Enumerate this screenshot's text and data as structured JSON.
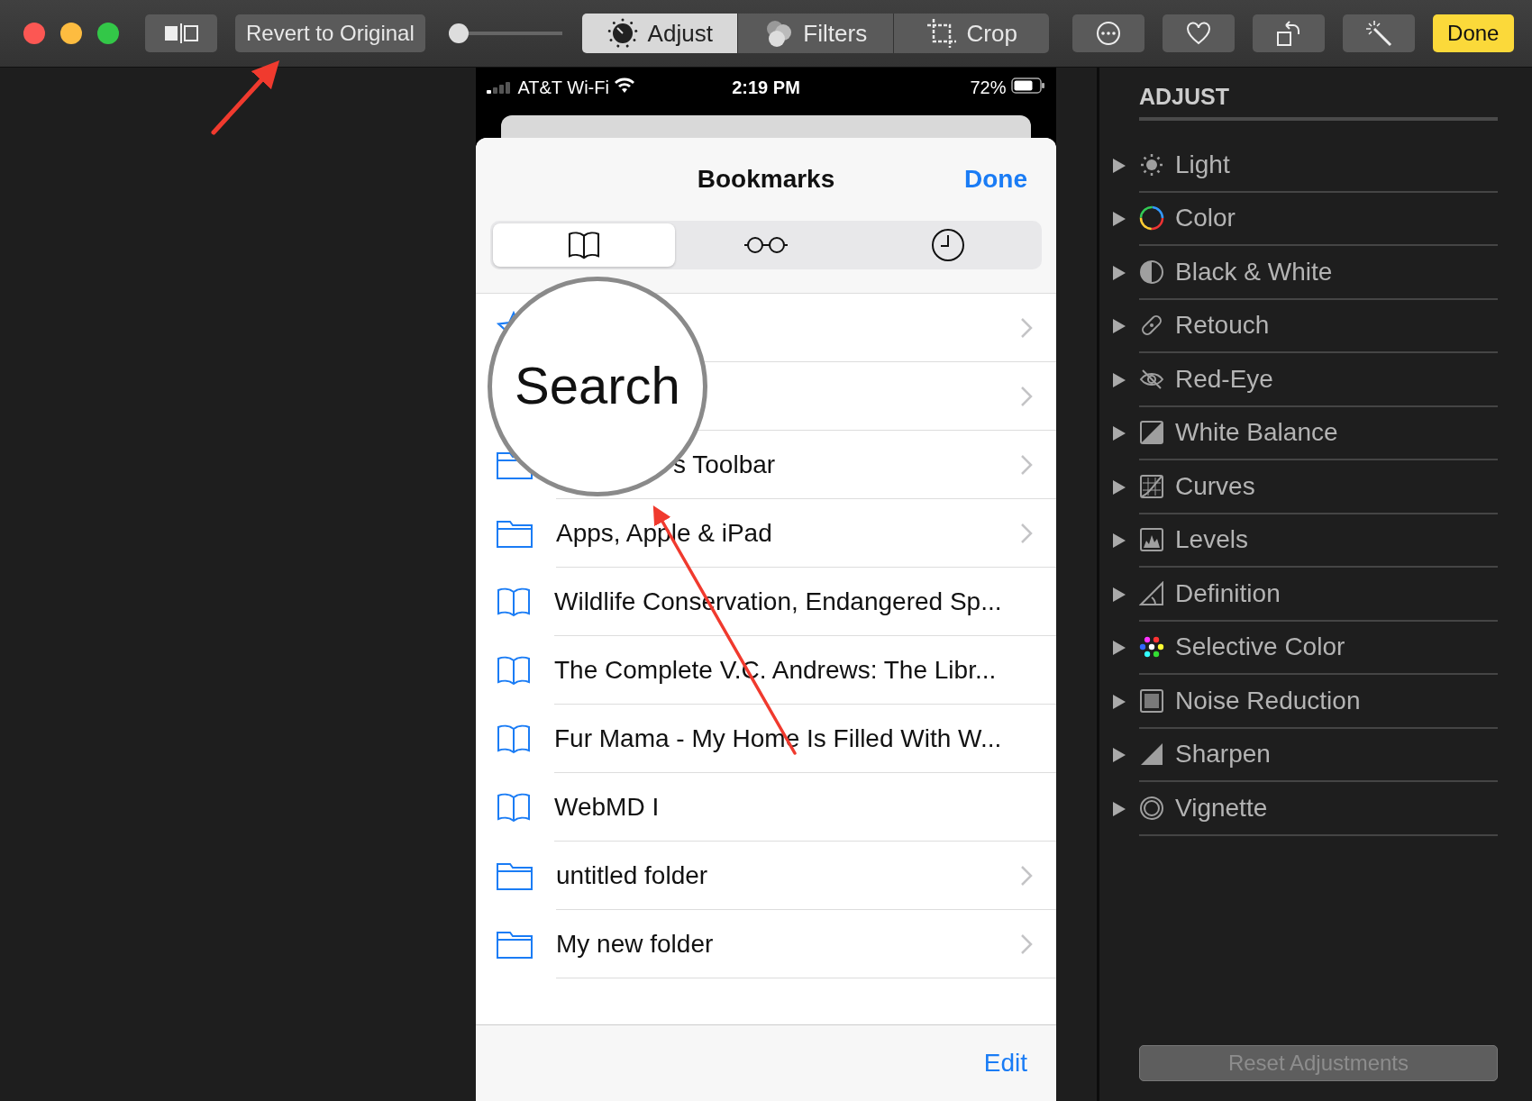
{
  "toolbar": {
    "revert_button": "Revert to Original",
    "slider": {
      "level": 0
    },
    "modes": [
      {
        "label": "Adjust",
        "selected": true
      },
      {
        "label": "Filters",
        "selected": false
      },
      {
        "label": "Crop",
        "selected": false
      }
    ],
    "done_button": "Done"
  },
  "phone": {
    "status_bar": {
      "carrier": "AT&T Wi-Fi",
      "time": "2:19 PM",
      "battery": "72%"
    },
    "title": "Bookmarks",
    "done": "Done",
    "tabs": [
      {
        "selected": true
      },
      {
        "selected": false
      },
      {
        "selected": false
      }
    ],
    "rows": [
      {
        "kind": "favorites",
        "chevron": true
      },
      {
        "kind": "blank",
        "chevron": true
      },
      {
        "kind": "folder",
        "title": "s Toolbar",
        "chevron": true,
        "covered": true
      },
      {
        "kind": "folder",
        "title": "Apps, Apple & iPad",
        "chevron": true,
        "covered": false
      },
      {
        "kind": "bookmark",
        "title": "Wildlife Conservation, Endangered Sp...",
        "chevron": false,
        "covered": false
      },
      {
        "kind": "bookmark",
        "title": "The Complete V.C. Andrews: The Libr...",
        "chevron": false,
        "covered": false
      },
      {
        "kind": "bookmark",
        "title": "Fur Mama - My Home Is Filled With W...",
        "chevron": false,
        "covered": false
      },
      {
        "kind": "bookmark",
        "title": "WebMD I",
        "chevron": false,
        "covered": false
      },
      {
        "kind": "folder",
        "title": "untitled folder",
        "chevron": true,
        "covered": false
      },
      {
        "kind": "folder",
        "title": "My new folder",
        "chevron": true,
        "covered": false
      }
    ],
    "edit": "Edit"
  },
  "magnifier": {
    "text": "Search"
  },
  "adjust_panel": {
    "heading": "ADJUST",
    "items": [
      {
        "label": "Light",
        "expanded": false
      },
      {
        "label": "Color",
        "expanded": false
      },
      {
        "label": "Black & White",
        "expanded": false
      },
      {
        "label": "Retouch",
        "expanded": false
      },
      {
        "label": "Red-Eye",
        "expanded": false
      },
      {
        "label": "White Balance",
        "expanded": false
      },
      {
        "label": "Curves",
        "expanded": false
      },
      {
        "label": "Levels",
        "expanded": false
      },
      {
        "label": "Definition",
        "expanded": false
      },
      {
        "label": "Selective Color",
        "expanded": false
      },
      {
        "label": "Noise Reduction",
        "expanded": false
      },
      {
        "label": "Sharpen",
        "expanded": false
      },
      {
        "label": "Vignette",
        "expanded": false
      }
    ],
    "reset_button": {
      "label": "Reset Adjustments",
      "disabled": true
    }
  }
}
